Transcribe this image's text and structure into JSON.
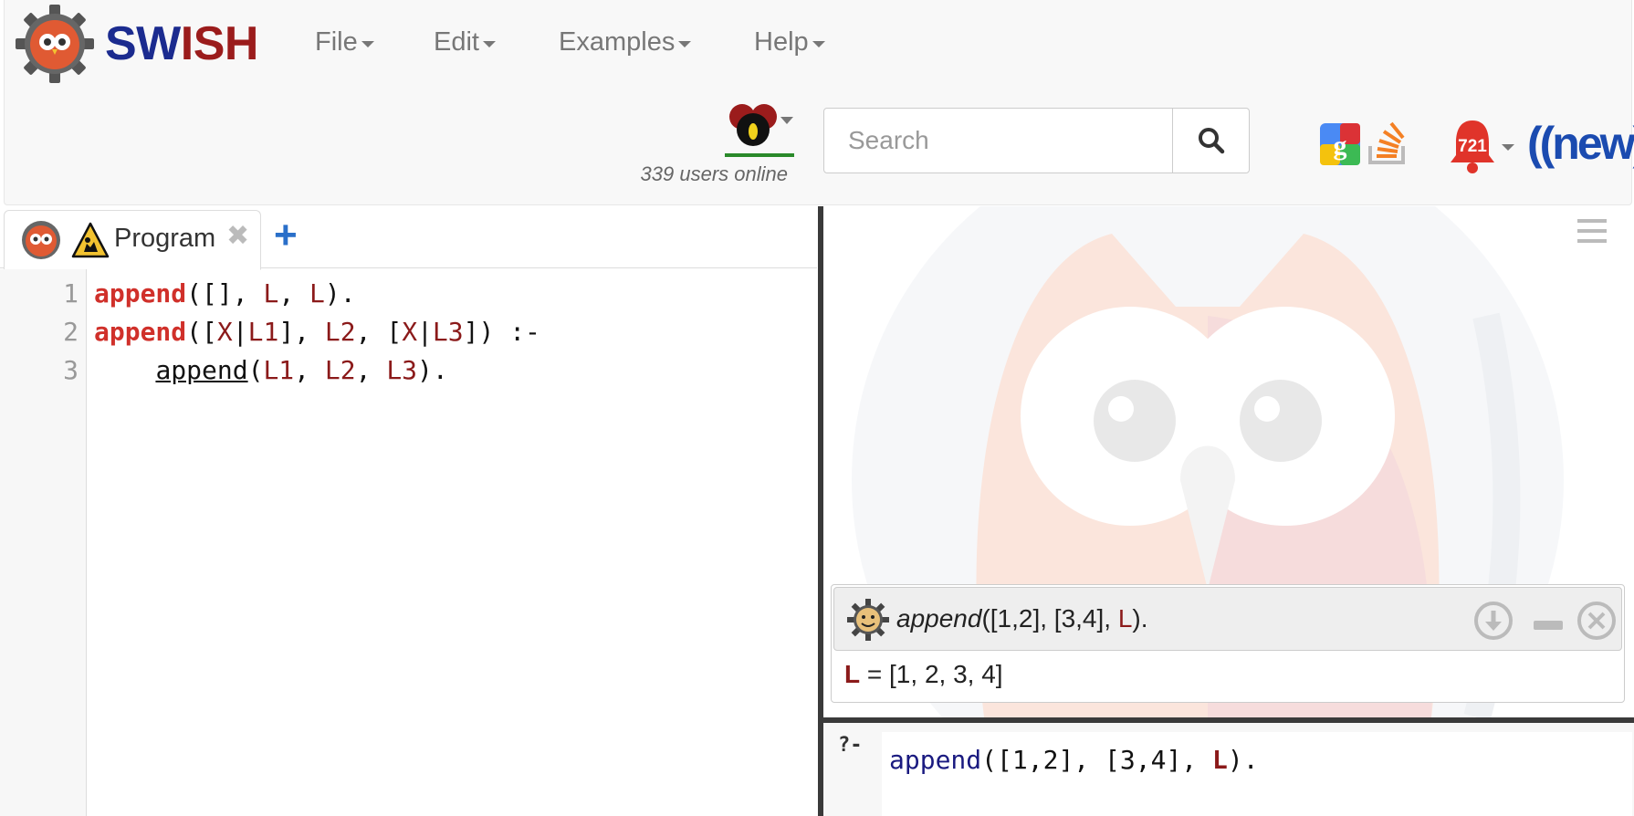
{
  "app": {
    "brand": {
      "sw": "SW",
      "ish": "ISH"
    }
  },
  "menu": {
    "file": "File",
    "edit": "Edit",
    "examples": "Examples",
    "help": "Help"
  },
  "status": {
    "users_online": "339 users online"
  },
  "search": {
    "placeholder": "Search",
    "value": ""
  },
  "notifications": {
    "count": "721",
    "new_badge": "((new))"
  },
  "icons": {
    "logo": "swish-gear-owl-logo",
    "user": "user-avatar-icon",
    "search": "search-icon",
    "google": "google-icon",
    "stackoverflow": "stackoverflow-icon",
    "bell": "bell-icon",
    "warning": "warning-icon",
    "menu": "hamburger-icon",
    "download": "download-icon",
    "minimize": "minimize-icon",
    "close": "close-icon"
  },
  "editor": {
    "tab_label": "Program",
    "tab_close": "✖",
    "tab_add": "+",
    "line_numbers": [
      "1",
      "2",
      "3"
    ]
  },
  "answer": {
    "pred": "append",
    "args_before": "([1,2], [3,4], ",
    "var": "L",
    "args_after": ").",
    "result_var": "L",
    "result_eq": " = ",
    "result_value": "[1, 2, 3, 4]"
  },
  "query": {
    "prompt": "?-",
    "pred": "append",
    "args_before": "([1,2], [3,4], ",
    "var": "L",
    "args_after": ")."
  },
  "colors": {
    "brand_blue": "#1b2b8f",
    "brand_red": "#9b1c1c",
    "keyword_red": "#d0302a",
    "variable": "#8b1a1a",
    "online_green": "#2a8a2a",
    "link_blue": "#2a6fc9"
  }
}
